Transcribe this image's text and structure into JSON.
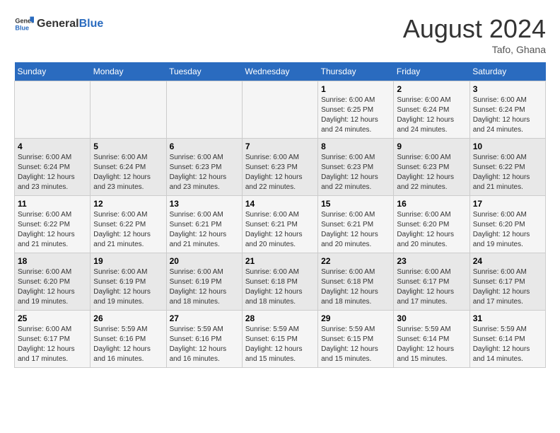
{
  "header": {
    "logo_line1": "General",
    "logo_line2": "Blue",
    "month_year": "August 2024",
    "location": "Tafo, Ghana"
  },
  "days_of_week": [
    "Sunday",
    "Monday",
    "Tuesday",
    "Wednesday",
    "Thursday",
    "Friday",
    "Saturday"
  ],
  "weeks": [
    [
      {
        "day": "",
        "info": ""
      },
      {
        "day": "",
        "info": ""
      },
      {
        "day": "",
        "info": ""
      },
      {
        "day": "",
        "info": ""
      },
      {
        "day": "1",
        "info": "Sunrise: 6:00 AM\nSunset: 6:25 PM\nDaylight: 12 hours\nand 24 minutes."
      },
      {
        "day": "2",
        "info": "Sunrise: 6:00 AM\nSunset: 6:24 PM\nDaylight: 12 hours\nand 24 minutes."
      },
      {
        "day": "3",
        "info": "Sunrise: 6:00 AM\nSunset: 6:24 PM\nDaylight: 12 hours\nand 24 minutes."
      }
    ],
    [
      {
        "day": "4",
        "info": "Sunrise: 6:00 AM\nSunset: 6:24 PM\nDaylight: 12 hours\nand 23 minutes."
      },
      {
        "day": "5",
        "info": "Sunrise: 6:00 AM\nSunset: 6:24 PM\nDaylight: 12 hours\nand 23 minutes."
      },
      {
        "day": "6",
        "info": "Sunrise: 6:00 AM\nSunset: 6:23 PM\nDaylight: 12 hours\nand 23 minutes."
      },
      {
        "day": "7",
        "info": "Sunrise: 6:00 AM\nSunset: 6:23 PM\nDaylight: 12 hours\nand 22 minutes."
      },
      {
        "day": "8",
        "info": "Sunrise: 6:00 AM\nSunset: 6:23 PM\nDaylight: 12 hours\nand 22 minutes."
      },
      {
        "day": "9",
        "info": "Sunrise: 6:00 AM\nSunset: 6:23 PM\nDaylight: 12 hours\nand 22 minutes."
      },
      {
        "day": "10",
        "info": "Sunrise: 6:00 AM\nSunset: 6:22 PM\nDaylight: 12 hours\nand 21 minutes."
      }
    ],
    [
      {
        "day": "11",
        "info": "Sunrise: 6:00 AM\nSunset: 6:22 PM\nDaylight: 12 hours\nand 21 minutes."
      },
      {
        "day": "12",
        "info": "Sunrise: 6:00 AM\nSunset: 6:22 PM\nDaylight: 12 hours\nand 21 minutes."
      },
      {
        "day": "13",
        "info": "Sunrise: 6:00 AM\nSunset: 6:21 PM\nDaylight: 12 hours\nand 21 minutes."
      },
      {
        "day": "14",
        "info": "Sunrise: 6:00 AM\nSunset: 6:21 PM\nDaylight: 12 hours\nand 20 minutes."
      },
      {
        "day": "15",
        "info": "Sunrise: 6:00 AM\nSunset: 6:21 PM\nDaylight: 12 hours\nand 20 minutes."
      },
      {
        "day": "16",
        "info": "Sunrise: 6:00 AM\nSunset: 6:20 PM\nDaylight: 12 hours\nand 20 minutes."
      },
      {
        "day": "17",
        "info": "Sunrise: 6:00 AM\nSunset: 6:20 PM\nDaylight: 12 hours\nand 19 minutes."
      }
    ],
    [
      {
        "day": "18",
        "info": "Sunrise: 6:00 AM\nSunset: 6:20 PM\nDaylight: 12 hours\nand 19 minutes."
      },
      {
        "day": "19",
        "info": "Sunrise: 6:00 AM\nSunset: 6:19 PM\nDaylight: 12 hours\nand 19 minutes."
      },
      {
        "day": "20",
        "info": "Sunrise: 6:00 AM\nSunset: 6:19 PM\nDaylight: 12 hours\nand 18 minutes."
      },
      {
        "day": "21",
        "info": "Sunrise: 6:00 AM\nSunset: 6:18 PM\nDaylight: 12 hours\nand 18 minutes."
      },
      {
        "day": "22",
        "info": "Sunrise: 6:00 AM\nSunset: 6:18 PM\nDaylight: 12 hours\nand 18 minutes."
      },
      {
        "day": "23",
        "info": "Sunrise: 6:00 AM\nSunset: 6:17 PM\nDaylight: 12 hours\nand 17 minutes."
      },
      {
        "day": "24",
        "info": "Sunrise: 6:00 AM\nSunset: 6:17 PM\nDaylight: 12 hours\nand 17 minutes."
      }
    ],
    [
      {
        "day": "25",
        "info": "Sunrise: 6:00 AM\nSunset: 6:17 PM\nDaylight: 12 hours\nand 17 minutes."
      },
      {
        "day": "26",
        "info": "Sunrise: 5:59 AM\nSunset: 6:16 PM\nDaylight: 12 hours\nand 16 minutes."
      },
      {
        "day": "27",
        "info": "Sunrise: 5:59 AM\nSunset: 6:16 PM\nDaylight: 12 hours\nand 16 minutes."
      },
      {
        "day": "28",
        "info": "Sunrise: 5:59 AM\nSunset: 6:15 PM\nDaylight: 12 hours\nand 15 minutes."
      },
      {
        "day": "29",
        "info": "Sunrise: 5:59 AM\nSunset: 6:15 PM\nDaylight: 12 hours\nand 15 minutes."
      },
      {
        "day": "30",
        "info": "Sunrise: 5:59 AM\nSunset: 6:14 PM\nDaylight: 12 hours\nand 15 minutes."
      },
      {
        "day": "31",
        "info": "Sunrise: 5:59 AM\nSunset: 6:14 PM\nDaylight: 12 hours\nand 14 minutes."
      }
    ]
  ]
}
